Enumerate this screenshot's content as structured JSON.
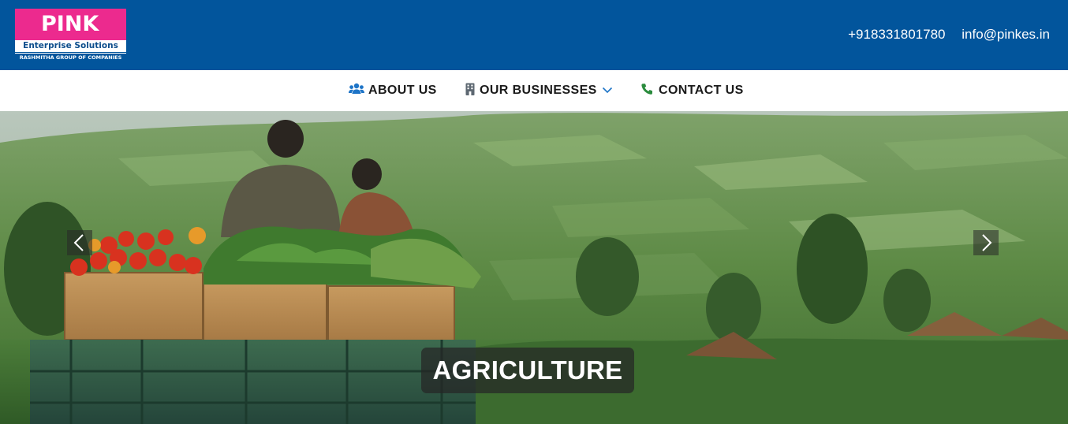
{
  "header": {
    "logo": {
      "brand": "PINK",
      "subtitle": "Enterprise Solutions",
      "group": "RASHMITHA GROUP OF COMPANIES"
    },
    "phone": "+918331801780",
    "email": "info@pinkes.in"
  },
  "nav": {
    "items": [
      {
        "label": "ABOUT US",
        "icon": "users-icon"
      },
      {
        "label": "OUR BUSINESSES",
        "icon": "building-icon",
        "has_dropdown": true
      },
      {
        "label": "CONTACT US",
        "icon": "phone-icon"
      }
    ]
  },
  "hero": {
    "caption": "AGRICULTURE",
    "prev_icon": "chevron-left-icon",
    "next_icon": "chevron-right-icon"
  },
  "colors": {
    "header_bg": "#02559c",
    "logo_pink": "#ec2a8e",
    "nav_icon_blue": "#1d74c7",
    "nav_icon_gray": "#5e6872",
    "nav_icon_green": "#2a8b3d"
  }
}
